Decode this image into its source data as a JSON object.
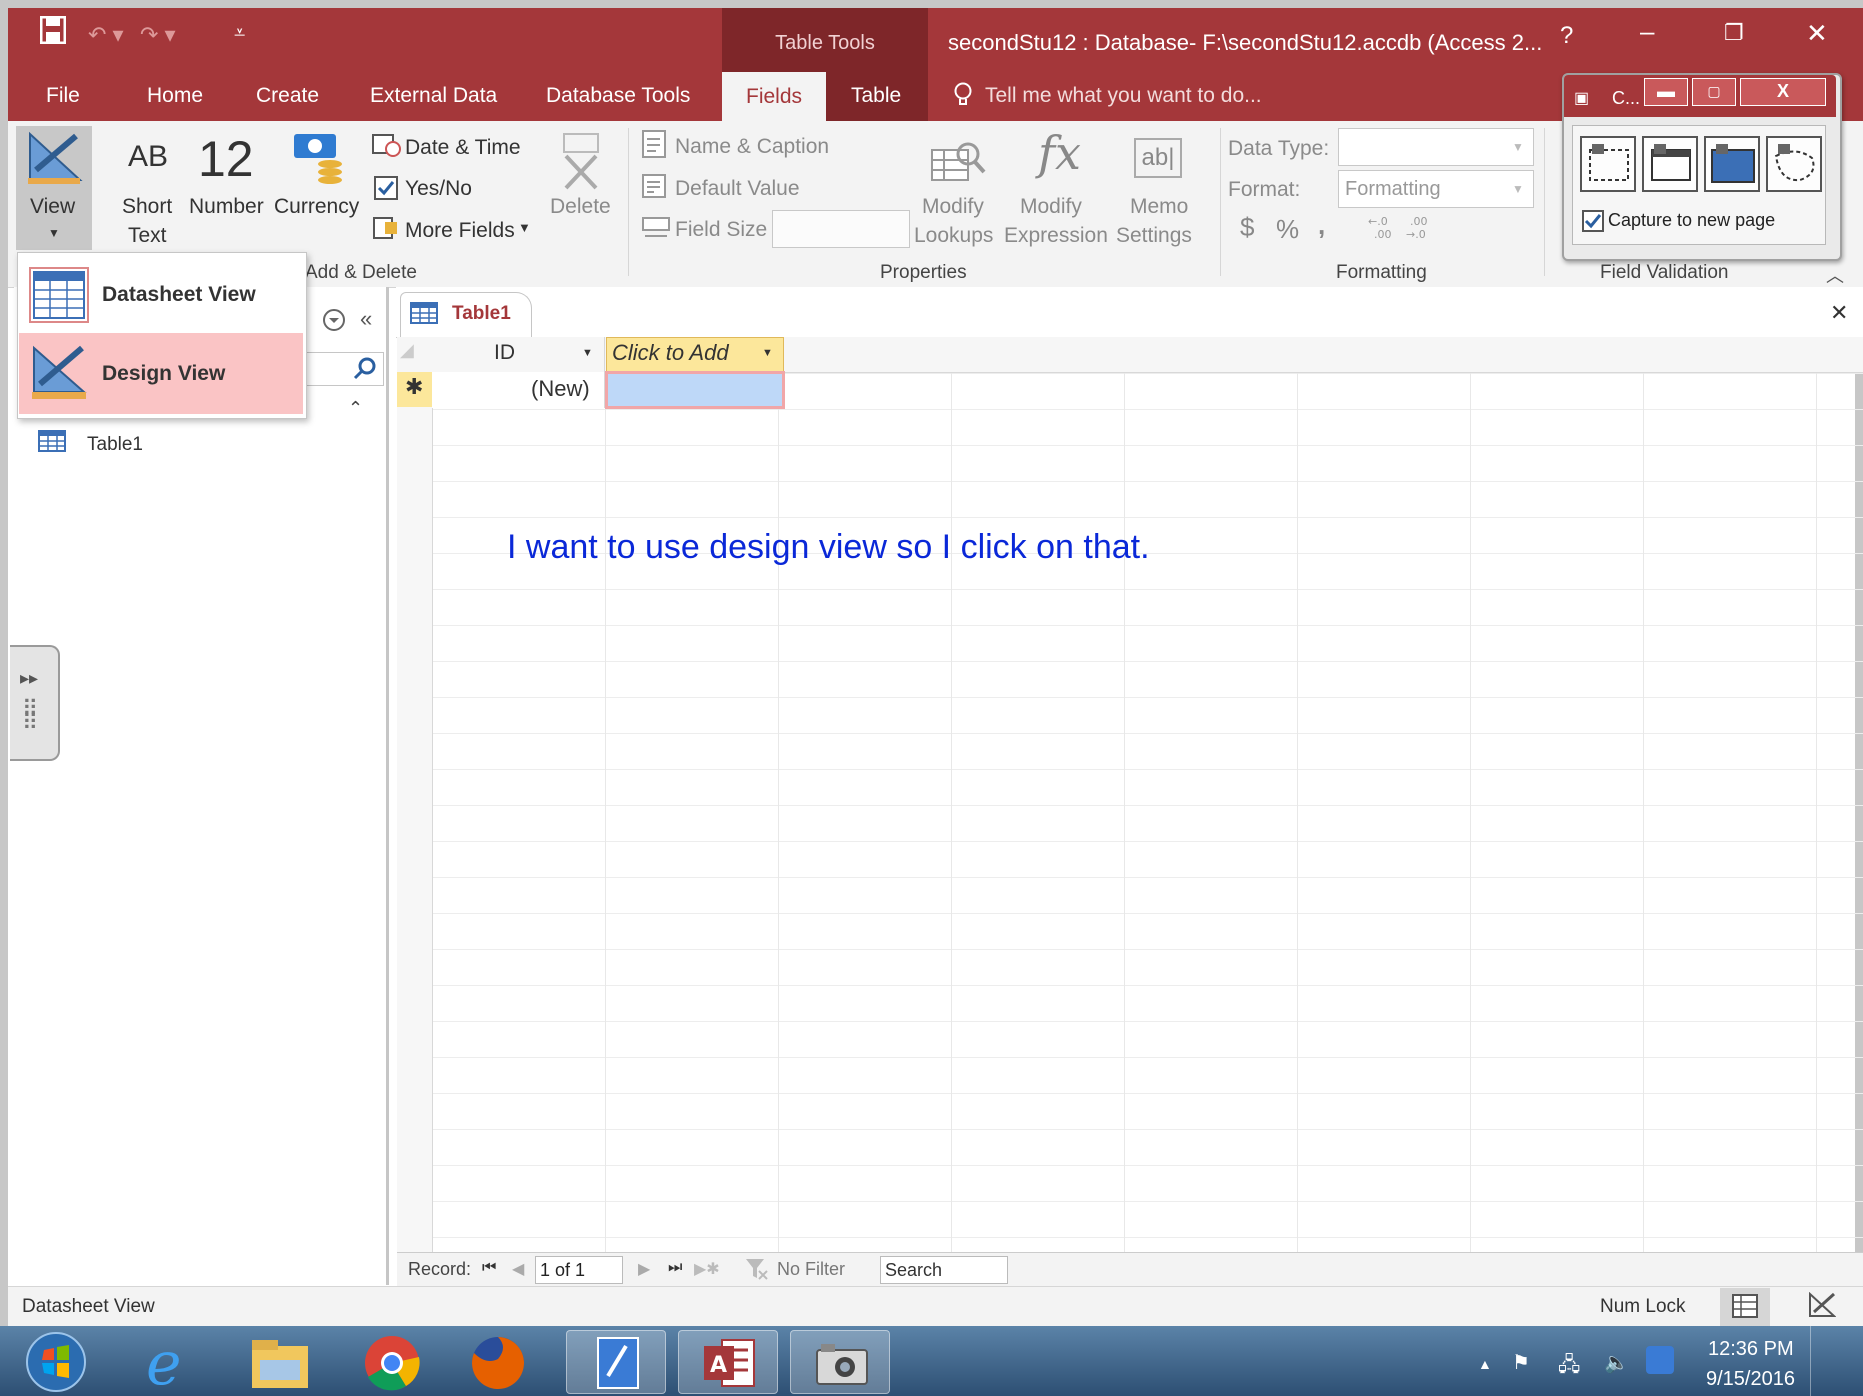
{
  "app": {
    "title": "secondStu12 : Database- F:\\secondStu12.accdb (Access 2...",
    "context_group": "Table Tools",
    "help": "?",
    "tabs": [
      "File",
      "Home",
      "Create",
      "External Data",
      "Database Tools",
      "Fields",
      "Table"
    ],
    "active_tab": "Fields",
    "tell_me": "Tell me what you want to do...",
    "brand_color": "#a4373a"
  },
  "ribbon": {
    "view_label": "View",
    "short_text": [
      "AB",
      "Short",
      "Text"
    ],
    "number": [
      "12",
      "Number"
    ],
    "currency": "Currency",
    "date_time": "Date & Time",
    "yes_no": "Yes/No",
    "more_fields": "More Fields",
    "delete": "Delete",
    "add_delete_group": "Add & Delete",
    "name_caption": "Name & Caption",
    "default_value": "Default Value",
    "field_size": "Field Size",
    "modify_lookups": [
      "Modify",
      "Lookups"
    ],
    "modify_expression": [
      "fx",
      "Modify",
      "Expression"
    ],
    "memo_settings": [
      "ab|",
      "Memo",
      "Settings"
    ],
    "properties_group": "Properties",
    "data_type_label": "Data Type:",
    "format_label": "Format:",
    "format_value": "Formatting",
    "formatting_symbols": [
      "$",
      "%",
      ","
    ],
    "formatting_group": "Formatting",
    "field_validation_group": "Field Validation"
  },
  "view_menu": {
    "datasheet": "Datasheet View",
    "design": "Design View"
  },
  "nav": {
    "table_item": "Table1"
  },
  "document": {
    "tab": "Table1",
    "columns": [
      "ID",
      "Click to Add"
    ],
    "new_row": "(New)",
    "record_label": "Record:",
    "record_pos": "1 of 1",
    "filter": "No Filter",
    "search": "Search"
  },
  "annotation": "I want to use design view so I click on that.",
  "capture": {
    "title": "C...",
    "checkbox_label": "Capture to new page",
    "checked": true
  },
  "status": {
    "left": "Datasheet View",
    "num_lock": "Num Lock"
  },
  "taskbar": {
    "time": "12:36 PM",
    "date": "9/15/2016"
  }
}
